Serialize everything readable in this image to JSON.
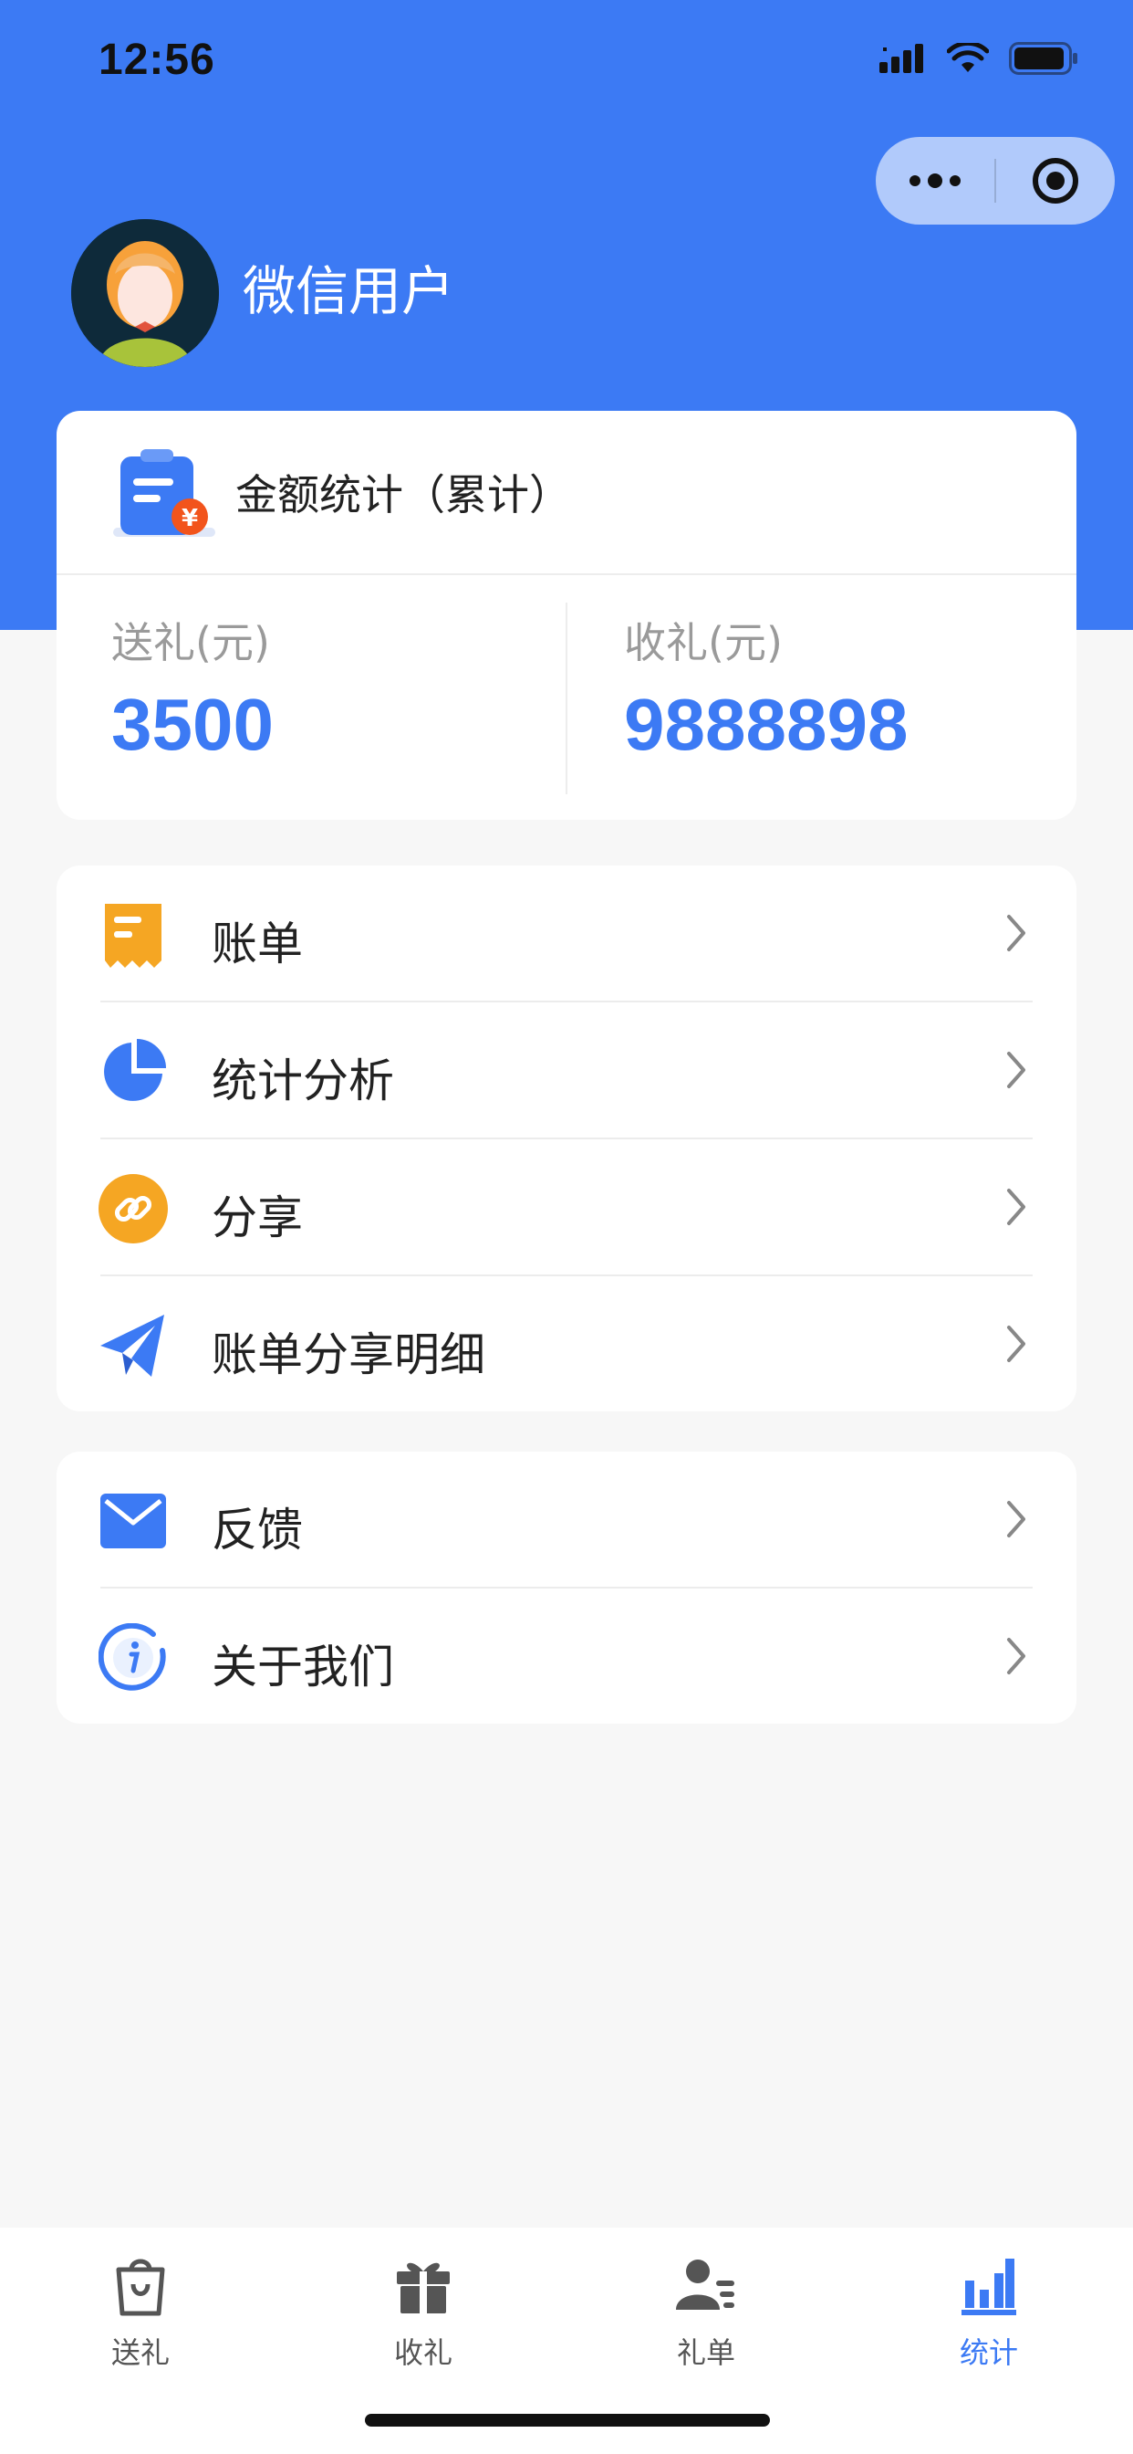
{
  "status_bar": {
    "time": "12:56"
  },
  "user": {
    "name": "微信用户"
  },
  "stats": {
    "title": "金额统计（累计）",
    "send_label": "送礼(元)",
    "send_value": "3500",
    "receive_label": "收礼(元)",
    "receive_value": "9888898"
  },
  "menu_group1": [
    {
      "label": "账单",
      "icon": "receipt-icon"
    },
    {
      "label": "统计分析",
      "icon": "pie-chart-icon"
    },
    {
      "label": "分享",
      "icon": "link-icon"
    },
    {
      "label": "账单分享明细",
      "icon": "paper-plane-icon"
    }
  ],
  "menu_group2": [
    {
      "label": "反馈",
      "icon": "mail-icon"
    },
    {
      "label": "关于我们",
      "icon": "info-icon"
    }
  ],
  "tabs": [
    {
      "label": "送礼",
      "icon": "gift-bag-icon",
      "active": false
    },
    {
      "label": "收礼",
      "icon": "gift-box-icon",
      "active": false
    },
    {
      "label": "礼单",
      "icon": "contact-list-icon",
      "active": false
    },
    {
      "label": "统计",
      "icon": "bar-chart-icon",
      "active": true
    }
  ],
  "colors": {
    "primary": "#3c7af4",
    "orange": "#f5a623",
    "background": "#f7f7f7"
  }
}
